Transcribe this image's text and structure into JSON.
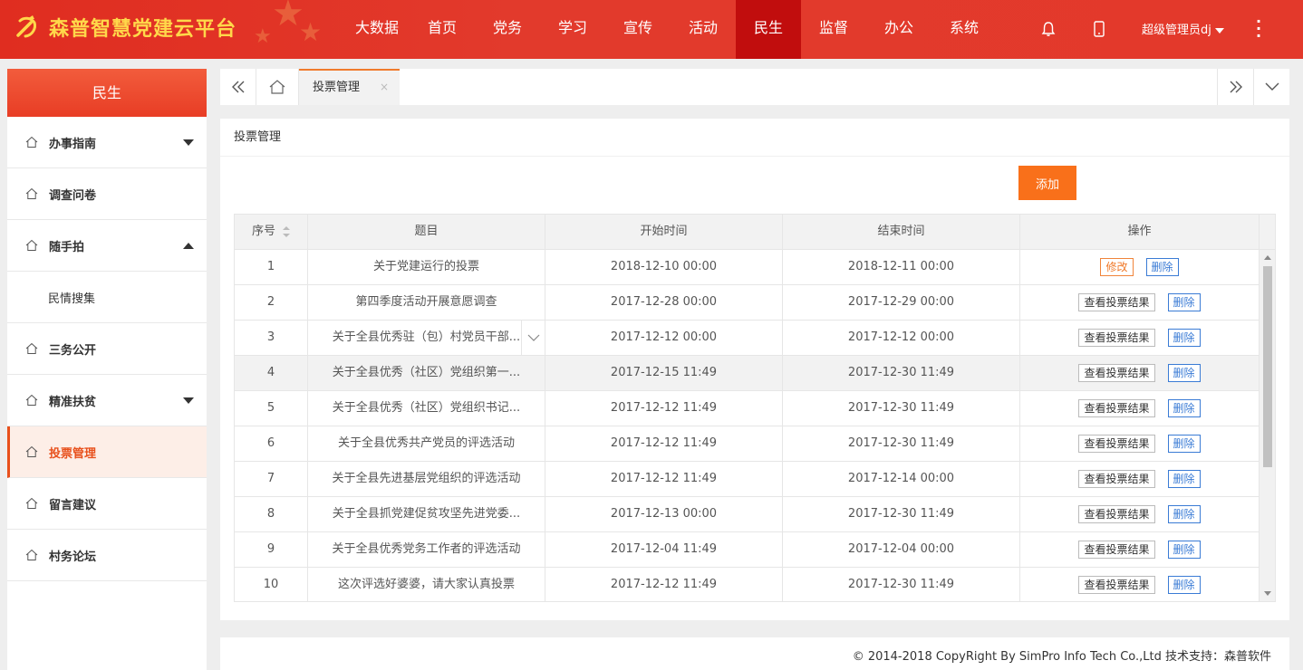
{
  "app": {
    "title": "森普智慧党建云平台",
    "user": "超级管理员dj"
  },
  "colors": {
    "header": "#e23a2c",
    "active_nav": "#c10d0d",
    "accent": "#f9701a",
    "link_blue": "#3a7bd5"
  },
  "nav": [
    "大数据",
    "首页",
    "党务",
    "学习",
    "宣传",
    "活动",
    "民生",
    "监督",
    "办公",
    "系统"
  ],
  "nav_active": "民生",
  "sidebar": {
    "title": "民生",
    "items": [
      {
        "label": "办事指南",
        "arrow": "down"
      },
      {
        "label": "调查问卷"
      },
      {
        "label": "随手拍",
        "arrow": "up"
      },
      {
        "label": "民情搜集",
        "sub": true
      },
      {
        "label": "三务公开"
      },
      {
        "label": "精准扶贫",
        "arrow": "down"
      },
      {
        "label": "投票管理",
        "active": true
      },
      {
        "label": "留言建议"
      },
      {
        "label": "村务论坛"
      }
    ]
  },
  "tabs": {
    "active": "投票管理",
    "close_glyph": "×"
  },
  "panel": {
    "title": "投票管理",
    "add_label": "添加"
  },
  "table": {
    "headers": [
      "序号",
      "题目",
      "开始时间",
      "结束时间",
      "操作"
    ],
    "edit_label": "修改",
    "delete_label": "删除",
    "view_label": "查看投票结果",
    "rows": [
      {
        "no": "1",
        "title": "关于党建运行的投票",
        "start": "2018-12-10 00:00",
        "end": "2018-12-11 00:00",
        "first_action": "edit"
      },
      {
        "no": "2",
        "title": "第四季度活动开展意愿调查",
        "start": "2017-12-28 00:00",
        "end": "2017-12-29 00:00",
        "first_action": "view"
      },
      {
        "no": "3",
        "title": "关于全县优秀驻（包）村党员干部...",
        "start": "2017-12-12 00:00",
        "end": "2017-12-12 00:00",
        "first_action": "view",
        "expand": true
      },
      {
        "no": "4",
        "title": "关于全县优秀（社区）党组织第一...",
        "start": "2017-12-15 11:49",
        "end": "2017-12-30 11:49",
        "first_action": "view",
        "hover": true
      },
      {
        "no": "5",
        "title": "关于全县优秀（社区）党组织书记...",
        "start": "2017-12-12 11:49",
        "end": "2017-12-30 11:49",
        "first_action": "view"
      },
      {
        "no": "6",
        "title": "关于全县优秀共产党员的评选活动",
        "start": "2017-12-12 11:49",
        "end": "2017-12-30 11:49",
        "first_action": "view"
      },
      {
        "no": "7",
        "title": "关于全县先进基层党组织的评选活动",
        "start": "2017-12-12 11:49",
        "end": "2017-12-14 00:00",
        "first_action": "view"
      },
      {
        "no": "8",
        "title": "关于全县抓党建促贫攻坚先进党委...",
        "start": "2017-12-13 00:00",
        "end": "2017-12-30 11:49",
        "first_action": "view"
      },
      {
        "no": "9",
        "title": "关于全县优秀党务工作者的评选活动",
        "start": "2017-12-04 11:49",
        "end": "2017-12-04 00:00",
        "first_action": "view"
      },
      {
        "no": "10",
        "title": "这次评选好婆婆，请大家认真投票",
        "start": "2017-12-12 11:49",
        "end": "2017-12-30 11:49",
        "first_action": "view"
      }
    ]
  },
  "footer": "© 2014-2018 CopyRight By SimPro Info Tech Co.,Ltd 技术支持：森普软件"
}
